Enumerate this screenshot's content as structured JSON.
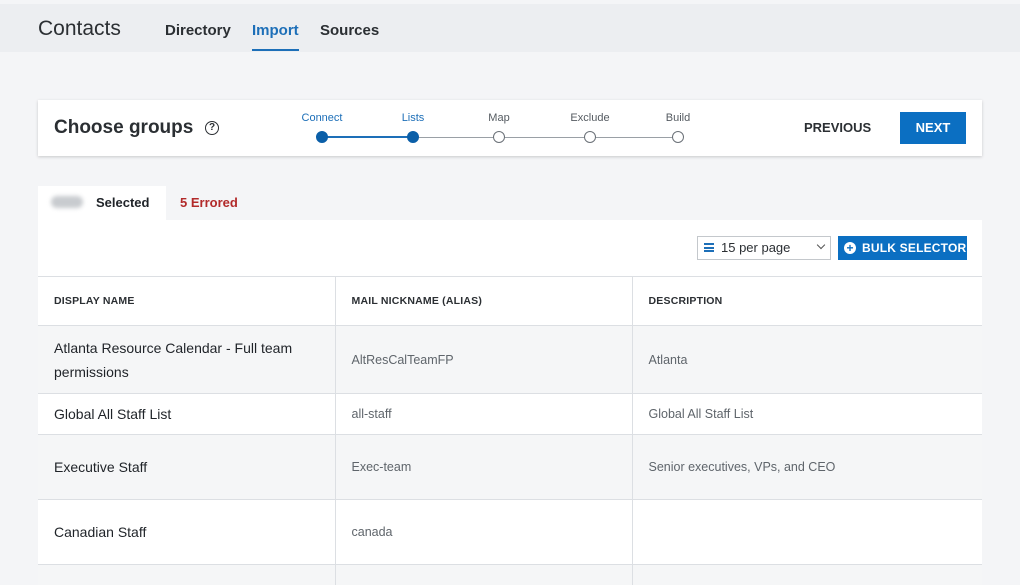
{
  "app": {
    "title": "Contacts",
    "nav": [
      {
        "label": "Directory",
        "active": false
      },
      {
        "label": "Import",
        "active": true
      },
      {
        "label": "Sources",
        "active": false
      }
    ]
  },
  "wizard": {
    "title": "Choose groups",
    "help_icon": "?",
    "steps": [
      {
        "label": "Connect",
        "done": true
      },
      {
        "label": "Lists",
        "done": true
      },
      {
        "label": "Map",
        "done": false
      },
      {
        "label": "Exclude",
        "done": false
      },
      {
        "label": "Build",
        "done": false
      }
    ],
    "previous_label": "PREVIOUS",
    "next_label": "NEXT"
  },
  "tabs": {
    "selected_label": "Selected",
    "errored_label": "5 Errored"
  },
  "toolbar": {
    "per_page_label": "15 per page",
    "bulk_selector_label": "BULK SELECTOR"
  },
  "table": {
    "columns": [
      "DISPLAY NAME",
      "MAIL NICKNAME (ALIAS)",
      "DESCRIPTION"
    ],
    "rows": [
      {
        "name": "Atlanta Resource Calendar - Full team permissions",
        "alias": "AltResCalTeamFP",
        "description": "Atlanta"
      },
      {
        "name": "Global All Staff List",
        "alias": "all-staff",
        "description": "Global All Staff List"
      },
      {
        "name": "Executive Staff",
        "alias": "Exec-team",
        "description": "Senior executives, VPs, and CEO"
      },
      {
        "name": "Canadian Staff",
        "alias": "canada",
        "description": ""
      }
    ]
  },
  "colors": {
    "accent": "#1d6fb8",
    "primary_button": "#0b6fc2",
    "error": "#b22a2a"
  }
}
